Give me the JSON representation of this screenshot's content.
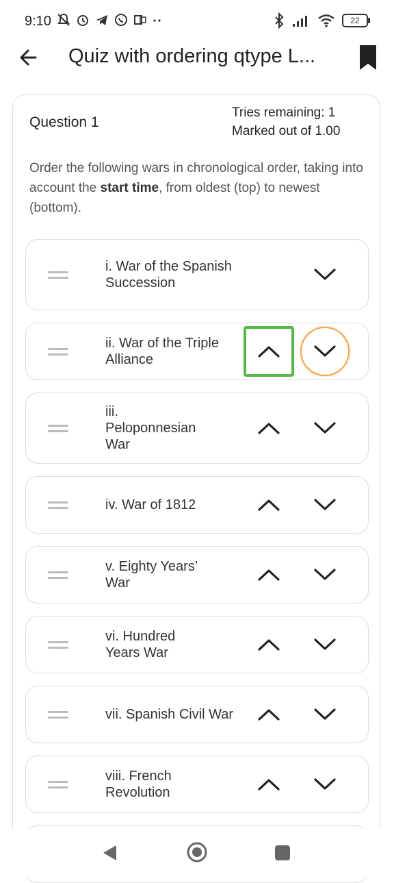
{
  "status": {
    "time": "9:10",
    "battery": "22"
  },
  "appbar": {
    "title": "Quiz with ordering qtype L..."
  },
  "question": {
    "title": "Question 1",
    "tries": "Tries remaining: 1",
    "marked": "Marked out of 1.00",
    "text_before": "Order the following wars in chronological order, taking into account the ",
    "text_bold": "start time",
    "text_after": ", from oldest (top) to newest (bottom)."
  },
  "items": [
    {
      "label": "i. War of the Spanish Succession"
    },
    {
      "label": "ii. War of the Triple Alliance"
    },
    {
      "label": "iii. Peloponnesian War"
    },
    {
      "label": "iv. War of 1812"
    },
    {
      "label": "v. Eighty Years’ War"
    },
    {
      "label": "vi. Hundred Years War"
    },
    {
      "label": "vii. Spanish Civil War"
    },
    {
      "label": "viii. French Revolution"
    }
  ],
  "colors": {
    "focus_outline": "#57b845",
    "hover_ring": "#f0a64a"
  }
}
